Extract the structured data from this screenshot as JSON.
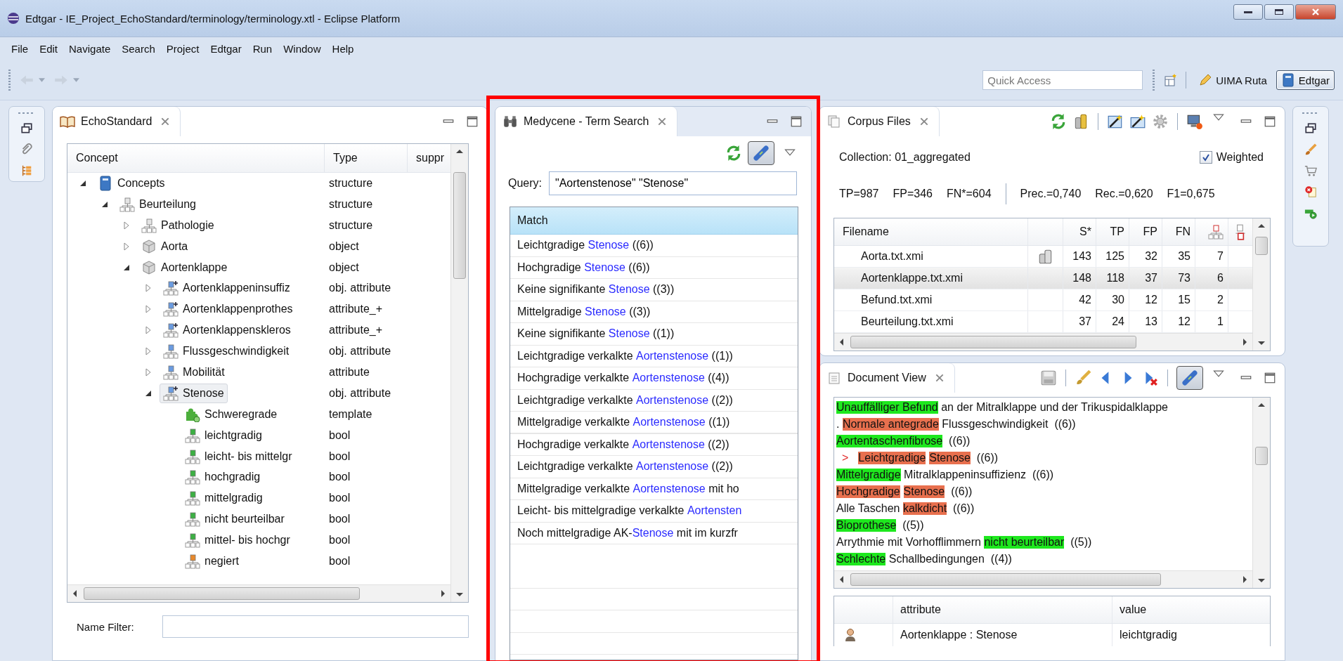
{
  "window": {
    "title": "Edtgar - IE_Project_EchoStandard/terminology/terminology.xtl - Eclipse Platform"
  },
  "menu": [
    "File",
    "Edit",
    "Navigate",
    "Search",
    "Project",
    "Edtgar",
    "Run",
    "Window",
    "Help"
  ],
  "toolbar": {
    "quick_access": {
      "placeholder": "Quick Access"
    },
    "perspectives": [
      {
        "label": "UIMA Ruta",
        "kind": "pencil",
        "selected": false
      },
      {
        "label": "Edtgar",
        "kind": "book",
        "selected": true
      }
    ]
  },
  "concept_view": {
    "tab": "EchoStandard",
    "columns": [
      "Concept",
      "Type",
      "suppr"
    ],
    "tree": [
      {
        "label": "Concepts",
        "type": "structure",
        "kind": "root",
        "expanded": true,
        "selected": false,
        "children": [
          {
            "label": "Beurteilung",
            "type": "structure",
            "kind": "structure",
            "expanded": true,
            "selected": false,
            "children": [
              {
                "label": "Pathologie",
                "type": "structure",
                "kind": "structure",
                "expanded": false,
                "selected": false
              },
              {
                "label": "Aorta",
                "type": "object",
                "kind": "object",
                "expanded": false,
                "selected": false
              },
              {
                "label": "Aortenklappe",
                "type": "object",
                "kind": "object",
                "expanded": true,
                "selected": false,
                "children": [
                  {
                    "label": "Aortenklappeninsuffiz",
                    "type": "obj. attribute",
                    "kind": "plusattr",
                    "expanded": false,
                    "selected": false
                  },
                  {
                    "label": "Aortenklappenprothes",
                    "type": "attribute_+",
                    "kind": "plusattr",
                    "expanded": false,
                    "selected": false
                  },
                  {
                    "label": "Aortenklappenskleros",
                    "type": "attribute_+",
                    "kind": "plusattr",
                    "expanded": false,
                    "selected": false
                  },
                  {
                    "label": "Flussgeschwindigkeit",
                    "type": "obj. attribute",
                    "kind": "attr",
                    "expanded": false,
                    "selected": false
                  },
                  {
                    "label": "Mobilität",
                    "type": "attribute",
                    "kind": "attr",
                    "expanded": false,
                    "selected": false
                  },
                  {
                    "label": "Stenose",
                    "type": "obj. attribute",
                    "kind": "plusattr",
                    "expanded": true,
                    "selected": true,
                    "children": [
                      {
                        "label": "Schweregrade",
                        "type": "template",
                        "kind": "template",
                        "selected": false
                      },
                      {
                        "label": "leichtgradig",
                        "type": "bool",
                        "kind": "boolean",
                        "selected": false
                      },
                      {
                        "label": "leicht- bis mittelgr",
                        "type": "bool",
                        "kind": "boolean",
                        "selected": false
                      },
                      {
                        "label": "hochgradig",
                        "type": "bool",
                        "kind": "boolean",
                        "selected": false
                      },
                      {
                        "label": "mittelgradig",
                        "type": "bool",
                        "kind": "boolean",
                        "selected": false
                      },
                      {
                        "label": "nicht beurteilbar",
                        "type": "bool",
                        "kind": "boolean",
                        "selected": false
                      },
                      {
                        "label": "mittel- bis hochgr",
                        "type": "bool",
                        "kind": "boolean",
                        "selected": false
                      },
                      {
                        "label": "negiert",
                        "type": "bool",
                        "kind": "negation",
                        "selected": false
                      }
                    ]
                  }
                ]
              }
            ]
          }
        ]
      }
    ],
    "name_filter": {
      "label": "Name Filter:"
    }
  },
  "term_search": {
    "tab": "Medycene - Term Search",
    "link_with_editor": true,
    "query": {
      "label": "Query:",
      "value": "\"Aortenstenose\" \"Stenose\""
    },
    "column": "Match",
    "matches": [
      {
        "parts": [
          {
            "text": "Leichtgradige ",
            "hit": false
          },
          {
            "text": "Stenose",
            "hit": true
          },
          {
            "text": " ((6))",
            "hit": false
          }
        ]
      },
      {
        "parts": [
          {
            "text": "Hochgradige ",
            "hit": false
          },
          {
            "text": "Stenose",
            "hit": true
          },
          {
            "text": " ((6))",
            "hit": false
          }
        ]
      },
      {
        "parts": [
          {
            "text": "Keine signifikante ",
            "hit": false
          },
          {
            "text": "Stenose",
            "hit": true
          },
          {
            "text": " ((3))",
            "hit": false
          }
        ]
      },
      {
        "parts": [
          {
            "text": "Mittelgradige ",
            "hit": false
          },
          {
            "text": "Stenose",
            "hit": true
          },
          {
            "text": " ((3))",
            "hit": false
          }
        ]
      },
      {
        "parts": [
          {
            "text": "Keine signifikante ",
            "hit": false
          },
          {
            "text": "Stenose",
            "hit": true
          },
          {
            "text": " ((1))",
            "hit": false
          }
        ]
      },
      {
        "parts": [
          {
            "text": "Leichtgradige verkalkte ",
            "hit": false
          },
          {
            "text": "Aortenstenose",
            "hit": true
          },
          {
            "text": " ((1))",
            "hit": false
          }
        ]
      },
      {
        "parts": [
          {
            "text": "Hochgradige verkalkte ",
            "hit": false
          },
          {
            "text": "Aortenstenose",
            "hit": true
          },
          {
            "text": " ((4))",
            "hit": false
          }
        ]
      },
      {
        "parts": [
          {
            "text": "Leichtgradige verkalkte ",
            "hit": false
          },
          {
            "text": "Aortenstenose",
            "hit": true
          },
          {
            "text": " ((2))",
            "hit": false
          }
        ]
      },
      {
        "parts": [
          {
            "text": "Mittelgradige verkalkte ",
            "hit": false
          },
          {
            "text": "Aortenstenose",
            "hit": true
          },
          {
            "text": " ((1))",
            "hit": false
          }
        ]
      },
      {
        "parts": [
          {
            "text": "Hochgradige verkalkte ",
            "hit": false
          },
          {
            "text": "Aortenstenose",
            "hit": true
          },
          {
            "text": " ((2))",
            "hit": false
          }
        ]
      },
      {
        "parts": [
          {
            "text": "Leichtgradige verkalkte ",
            "hit": false
          },
          {
            "text": "Aortenstenose",
            "hit": true
          },
          {
            "text": " ((2))",
            "hit": false
          }
        ]
      },
      {
        "parts": [
          {
            "text": "Mittelgradige verkalkte ",
            "hit": false
          },
          {
            "text": "Aortenstenose",
            "hit": true
          },
          {
            "text": " mit ho",
            "hit": false
          }
        ]
      },
      {
        "parts": [
          {
            "text": "Leicht- bis mittelgradige verkalkte ",
            "hit": false
          },
          {
            "text": "Aortensten",
            "hit": true
          }
        ]
      },
      {
        "parts": [
          {
            "text": "Noch mittelgradige AK-",
            "hit": false
          },
          {
            "text": "Stenose",
            "hit": true
          },
          {
            "text": " mit im kurzfr",
            "hit": false
          }
        ]
      }
    ]
  },
  "corpus_files": {
    "tab": "Corpus Files",
    "collection": "Collection: 01_aggregated",
    "weighted": {
      "label": "Weighted",
      "checked": true
    },
    "stats": [
      "TP=987",
      "FP=346",
      "FN*=604"
    ],
    "scores": [
      "Prec.=0,740",
      "Rec.=0,620",
      "F1=0,675"
    ],
    "columns": [
      "Filename",
      "S*",
      "TP",
      "FP",
      "FN"
    ],
    "rows": [
      {
        "cells": [
          "Aorta.txt.xmi",
          "143",
          "125",
          "32",
          "35",
          "7"
        ],
        "marked": true,
        "selected": false
      },
      {
        "cells": [
          "Aortenklappe.txt.xmi",
          "148",
          "118",
          "37",
          "73",
          "6"
        ],
        "marked": false,
        "selected": true
      },
      {
        "cells": [
          "Befund.txt.xmi",
          "42",
          "30",
          "12",
          "15",
          "2"
        ],
        "marked": false,
        "selected": false
      },
      {
        "cells": [
          "Beurteilung.txt.xmi",
          "37",
          "24",
          "13",
          "12",
          "1"
        ],
        "marked": false,
        "selected": false
      }
    ]
  },
  "document_view": {
    "tab": "Document View",
    "link_with_editor": true,
    "lines": [
      {
        "segments": [
          {
            "text": "Unauffälliger Befund",
            "color": "#1ee81e"
          },
          {
            "text": " an der Mitralklappe und der Trikuspidalklappe"
          }
        ]
      },
      {
        "segments": [
          {
            "text": ". "
          },
          {
            "text": "Normale antegrade",
            "color": "#e8704e"
          },
          {
            "text": " Flussgeschwindigkeit  ((6))"
          }
        ]
      },
      {
        "segments": [
          {
            "text": "Aortentaschenfibrose",
            "color": "#1ee81e"
          },
          {
            "text": "  ((6))"
          }
        ]
      },
      {
        "marker": ">",
        "segments": [
          {
            "text": "Leichtgradige",
            "color": "#e8704e"
          },
          {
            "text": "Stenose",
            "color": "#e8704e"
          },
          {
            "text": "  ((6))"
          }
        ]
      },
      {
        "segments": [
          {
            "text": "Mittelgradige",
            "color": "#1ee81e"
          },
          {
            "text": " Mitralklappeninsuffizienz  ((6))"
          }
        ]
      },
      {
        "segments": [
          {
            "text": "Hochgradige",
            "color": "#e8704e"
          },
          {
            "text": "Stenose",
            "color": "#e8704e"
          },
          {
            "text": "  ((6))"
          }
        ]
      },
      {
        "segments": [
          {
            "text": "Alle Taschen "
          },
          {
            "text": "kalkdicht",
            "color": "#e8704e"
          },
          {
            "text": "  ((6))"
          }
        ]
      },
      {
        "segments": [
          {
            "text": "Bioprothese",
            "color": "#1ee81e"
          },
          {
            "text": "  ((5))"
          }
        ]
      },
      {
        "segments": [
          {
            "text": "Arrythmie mit Vorhofflimmern "
          },
          {
            "text": "nicht beurteilbar",
            "color": "#1ee81e"
          },
          {
            "text": "  ((5))"
          }
        ]
      },
      {
        "segments": [
          {
            "text": "Schlechte",
            "color": "#1ee81e"
          },
          {
            "text": " Schallbedingungen  ((4))"
          }
        ]
      }
    ],
    "attributes": {
      "columns": [
        "attribute",
        "value"
      ],
      "rows": [
        {
          "attribute": "Aortenklappe : Stenose",
          "value": "leichtgradig"
        }
      ]
    }
  }
}
